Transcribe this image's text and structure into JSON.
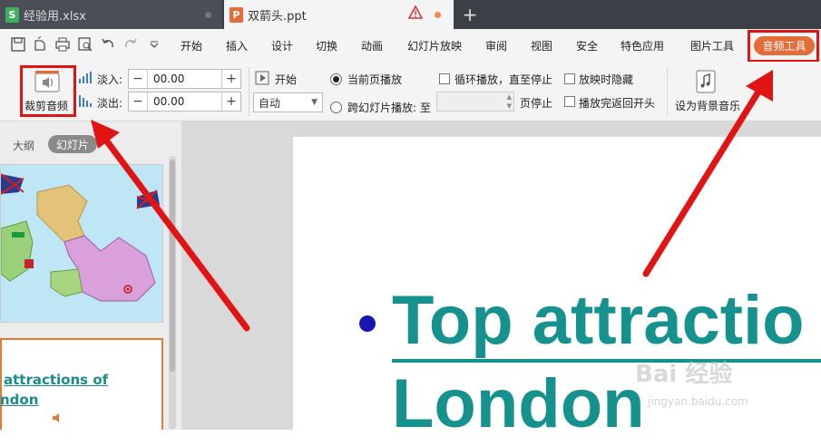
{
  "tabs": [
    {
      "title": "经验用.xlsx",
      "icon": "spreadsheet-icon",
      "icon_letter": "S",
      "icon_color": "#3fae5f"
    },
    {
      "title": "双箭头.ppt",
      "icon": "presentation-icon",
      "icon_letter": "P",
      "icon_color": "#e36c39"
    }
  ],
  "new_tab_label": "+",
  "menu": {
    "items": [
      "开始",
      "插入",
      "设计",
      "切换",
      "动画",
      "幻灯片放映",
      "审阅",
      "视图",
      "安全",
      "特色应用",
      "图片工具"
    ],
    "active": "音频工具"
  },
  "ribbon": {
    "trim_audio": "裁剪音频",
    "fade_in_label": "淡入:",
    "fade_in_value": "00.00",
    "fade_out_label": "淡出:",
    "fade_out_value": "00.00",
    "start_label": "开始",
    "start_mode": "自动",
    "play_current_slide": "当前页播放",
    "play_across_slides": "跨幻灯片播放: 至",
    "page_stop": "页停止",
    "loop_play": "循环播放，直至停止",
    "hide_during_show": "放映时隐藏",
    "rewind_after_play": "播放完返回开头",
    "set_background_music": "设为背景音乐"
  },
  "left_panel": {
    "tab_outline": "大纲",
    "tab_slides": "幻灯片",
    "thumb2_text_line1": "attractions of",
    "thumb2_text_line2": "ndon"
  },
  "slide": {
    "title_line1": "Top attractio",
    "title_line2": "London",
    "accent_color": "#15918e"
  },
  "watermark": {
    "text": "Bai 经验",
    "sub": "jingyan.baidu.com"
  }
}
